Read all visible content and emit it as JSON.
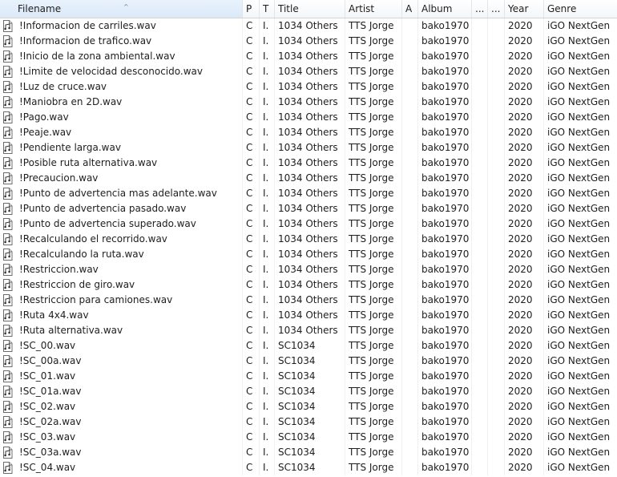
{
  "columns": {
    "filename": "Filename",
    "p": "P",
    "t": "T",
    "title": "Title",
    "artist": "Artist",
    "a": "A",
    "album": "Album",
    "c1": "...",
    "c2": "...",
    "year": "Year",
    "genre": "Genre"
  },
  "sort_indicator": "^",
  "icon": "wav-audio-file-icon",
  "rows": [
    {
      "filename": "!Informacion de carriles.wav",
      "p": "C",
      "t": "I.",
      "title": "1034 Others",
      "artist": "TTS Jorge",
      "album": "bako1970",
      "year": "2020",
      "genre": "iGO NextGen"
    },
    {
      "filename": "!Informacion de trafico.wav",
      "p": "C",
      "t": "I.",
      "title": "1034 Others",
      "artist": "TTS Jorge",
      "album": "bako1970",
      "year": "2020",
      "genre": "iGO NextGen"
    },
    {
      "filename": "!Inicio de la zona ambiental.wav",
      "p": "C",
      "t": "I.",
      "title": "1034 Others",
      "artist": "TTS Jorge",
      "album": "bako1970",
      "year": "2020",
      "genre": "iGO NextGen"
    },
    {
      "filename": "!Limite de velocidad desconocido.wav",
      "p": "C",
      "t": "I.",
      "title": "1034 Others",
      "artist": "TTS Jorge",
      "album": "bako1970",
      "year": "2020",
      "genre": "iGO NextGen"
    },
    {
      "filename": "!Luz de cruce.wav",
      "p": "C",
      "t": "I.",
      "title": "1034 Others",
      "artist": "TTS Jorge",
      "album": "bako1970",
      "year": "2020",
      "genre": "iGO NextGen"
    },
    {
      "filename": "!Maniobra en 2D.wav",
      "p": "C",
      "t": "I.",
      "title": "1034 Others",
      "artist": "TTS Jorge",
      "album": "bako1970",
      "year": "2020",
      "genre": "iGO NextGen"
    },
    {
      "filename": "!Pago.wav",
      "p": "C",
      "t": "I.",
      "title": "1034 Others",
      "artist": "TTS Jorge",
      "album": "bako1970",
      "year": "2020",
      "genre": "iGO NextGen"
    },
    {
      "filename": "!Peaje.wav",
      "p": "C",
      "t": "I.",
      "title": "1034 Others",
      "artist": "TTS Jorge",
      "album": "bako1970",
      "year": "2020",
      "genre": "iGO NextGen"
    },
    {
      "filename": "!Pendiente larga.wav",
      "p": "C",
      "t": "I.",
      "title": "1034 Others",
      "artist": "TTS Jorge",
      "album": "bako1970",
      "year": "2020",
      "genre": "iGO NextGen"
    },
    {
      "filename": "!Posible ruta alternativa.wav",
      "p": "C",
      "t": "I.",
      "title": "1034 Others",
      "artist": "TTS Jorge",
      "album": "bako1970",
      "year": "2020",
      "genre": "iGO NextGen"
    },
    {
      "filename": "!Precaucion.wav",
      "p": "C",
      "t": "I.",
      "title": "1034 Others",
      "artist": "TTS Jorge",
      "album": "bako1970",
      "year": "2020",
      "genre": "iGO NextGen"
    },
    {
      "filename": "!Punto de advertencia mas adelante.wav",
      "p": "C",
      "t": "I.",
      "title": "1034 Others",
      "artist": "TTS Jorge",
      "album": "bako1970",
      "year": "2020",
      "genre": "iGO NextGen"
    },
    {
      "filename": "!Punto de advertencia pasado.wav",
      "p": "C",
      "t": "I.",
      "title": "1034 Others",
      "artist": "TTS Jorge",
      "album": "bako1970",
      "year": "2020",
      "genre": "iGO NextGen"
    },
    {
      "filename": "!Punto de advertencia superado.wav",
      "p": "C",
      "t": "I.",
      "title": "1034 Others",
      "artist": "TTS Jorge",
      "album": "bako1970",
      "year": "2020",
      "genre": "iGO NextGen"
    },
    {
      "filename": "!Recalculando el recorrido.wav",
      "p": "C",
      "t": "I.",
      "title": "1034 Others",
      "artist": "TTS Jorge",
      "album": "bako1970",
      "year": "2020",
      "genre": "iGO NextGen"
    },
    {
      "filename": "!Recalculando la ruta.wav",
      "p": "C",
      "t": "I.",
      "title": "1034 Others",
      "artist": "TTS Jorge",
      "album": "bako1970",
      "year": "2020",
      "genre": "iGO NextGen"
    },
    {
      "filename": "!Restriccion.wav",
      "p": "C",
      "t": "I.",
      "title": "1034 Others",
      "artist": "TTS Jorge",
      "album": "bako1970",
      "year": "2020",
      "genre": "iGO NextGen"
    },
    {
      "filename": "!Restriccion de giro.wav",
      "p": "C",
      "t": "I.",
      "title": "1034 Others",
      "artist": "TTS Jorge",
      "album": "bako1970",
      "year": "2020",
      "genre": "iGO NextGen"
    },
    {
      "filename": "!Restriccion para camiones.wav",
      "p": "C",
      "t": "I.",
      "title": "1034 Others",
      "artist": "TTS Jorge",
      "album": "bako1970",
      "year": "2020",
      "genre": "iGO NextGen"
    },
    {
      "filename": "!Ruta 4x4.wav",
      "p": "C",
      "t": "I.",
      "title": "1034 Others",
      "artist": "TTS Jorge",
      "album": "bako1970",
      "year": "2020",
      "genre": "iGO NextGen"
    },
    {
      "filename": "!Ruta alternativa.wav",
      "p": "C",
      "t": "I.",
      "title": "1034 Others",
      "artist": "TTS Jorge",
      "album": "bako1970",
      "year": "2020",
      "genre": "iGO NextGen"
    },
    {
      "filename": "!SC_00.wav",
      "p": "C",
      "t": "I.",
      "title": "SC1034",
      "artist": "TTS Jorge",
      "album": "bako1970",
      "year": "2020",
      "genre": "iGO NextGen"
    },
    {
      "filename": "!SC_00a.wav",
      "p": "C",
      "t": "I.",
      "title": "SC1034",
      "artist": "TTS Jorge",
      "album": "bako1970",
      "year": "2020",
      "genre": "iGO NextGen"
    },
    {
      "filename": "!SC_01.wav",
      "p": "C",
      "t": "I.",
      "title": "SC1034",
      "artist": "TTS Jorge",
      "album": "bako1970",
      "year": "2020",
      "genre": "iGO NextGen"
    },
    {
      "filename": "!SC_01a.wav",
      "p": "C",
      "t": "I.",
      "title": "SC1034",
      "artist": "TTS Jorge",
      "album": "bako1970",
      "year": "2020",
      "genre": "iGO NextGen"
    },
    {
      "filename": "!SC_02.wav",
      "p": "C",
      "t": "I.",
      "title": "SC1034",
      "artist": "TTS Jorge",
      "album": "bako1970",
      "year": "2020",
      "genre": "iGO NextGen"
    },
    {
      "filename": "!SC_02a.wav",
      "p": "C",
      "t": "I.",
      "title": "SC1034",
      "artist": "TTS Jorge",
      "album": "bako1970",
      "year": "2020",
      "genre": "iGO NextGen"
    },
    {
      "filename": "!SC_03.wav",
      "p": "C",
      "t": "I.",
      "title": "SC1034",
      "artist": "TTS Jorge",
      "album": "bako1970",
      "year": "2020",
      "genre": "iGO NextGen"
    },
    {
      "filename": "!SC_03a.wav",
      "p": "C",
      "t": "I.",
      "title": "SC1034",
      "artist": "TTS Jorge",
      "album": "bako1970",
      "year": "2020",
      "genre": "iGO NextGen"
    },
    {
      "filename": "!SC_04.wav",
      "p": "C",
      "t": "I.",
      "title": "SC1034",
      "artist": "TTS Jorge",
      "album": "bako1970",
      "year": "2020",
      "genre": "iGO NextGen"
    }
  ]
}
